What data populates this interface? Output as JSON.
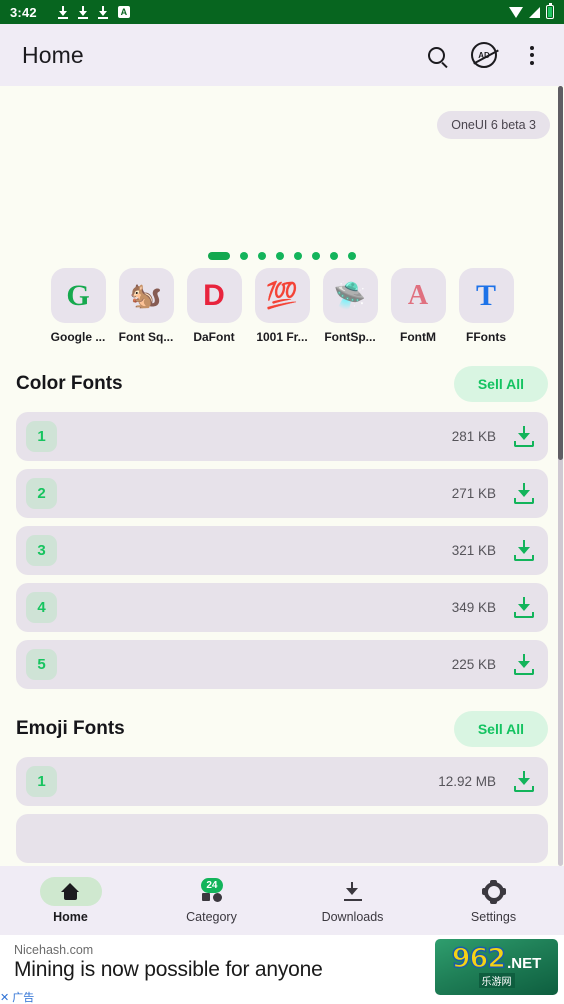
{
  "status_bar": {
    "time": "3:42",
    "download_icons": 3,
    "app_badge": "A",
    "background_color": "#07651f",
    "right_icons": [
      "wifi-icon",
      "signal-icon",
      "battery-icon"
    ]
  },
  "app_bar": {
    "title": "Home",
    "actions": [
      {
        "name": "search-button",
        "icon": "search-icon"
      },
      {
        "name": "remove-ads-button",
        "icon": "ad-block-icon",
        "label": "AD"
      },
      {
        "name": "overflow-menu-button",
        "icon": "more-vertical-icon"
      }
    ]
  },
  "carousel": {
    "chip_label": "OneUI 6 beta 3",
    "total_dots": 8,
    "active_index": 0
  },
  "sources": [
    {
      "label": "Google ...",
      "icon": "google-g-icon",
      "glyph": "G"
    },
    {
      "label": "Font Sq...",
      "icon": "squirrel-icon",
      "glyph": "🐿"
    },
    {
      "label": "DaFont",
      "icon": "dafont-d-icon",
      "glyph": "D"
    },
    {
      "label": "1001 Fr...",
      "icon": "hundred-points-icon",
      "glyph": "💯"
    },
    {
      "label": "FontSp...",
      "icon": "ufo-icon",
      "glyph": "🛸"
    },
    {
      "label": "FontM",
      "icon": "decorative-a-icon",
      "glyph": "A"
    },
    {
      "label": "FFonts",
      "icon": "blue-t-icon",
      "glyph": "T"
    }
  ],
  "sections": [
    {
      "title": "Color Fonts",
      "action_label": "Sell All",
      "rows": [
        {
          "rank": "1",
          "size": "281 KB"
        },
        {
          "rank": "2",
          "size": "271 KB"
        },
        {
          "rank": "3",
          "size": "321 KB"
        },
        {
          "rank": "4",
          "size": "349 KB"
        },
        {
          "rank": "5",
          "size": "225 KB"
        }
      ]
    },
    {
      "title": "Emoji Fonts",
      "action_label": "Sell All",
      "rows": [
        {
          "rank": "1",
          "size": "12.92 MB"
        }
      ]
    }
  ],
  "bottom_nav": [
    {
      "label": "Home",
      "icon": "home-icon",
      "active": true,
      "badge": ""
    },
    {
      "label": "Category",
      "icon": "shapes-icon",
      "active": false,
      "badge": "24"
    },
    {
      "label": "Downloads",
      "icon": "download-icon",
      "active": false,
      "badge": ""
    },
    {
      "label": "Settings",
      "icon": "gear-icon",
      "active": false,
      "badge": ""
    }
  ],
  "ad_banner": {
    "site": "Nicehash.com",
    "headline": "Mining is now possible for anyone",
    "close_label": "✕ 广告",
    "logo_main": "962",
    "logo_tld": ".NET",
    "logo_sub": "乐游网"
  },
  "colors": {
    "accent_green": "#13b45b",
    "status_bar": "#07651f",
    "surface": "#e7e2ea",
    "background": "#fbfcf3",
    "app_bar": "#f0ecf5"
  }
}
